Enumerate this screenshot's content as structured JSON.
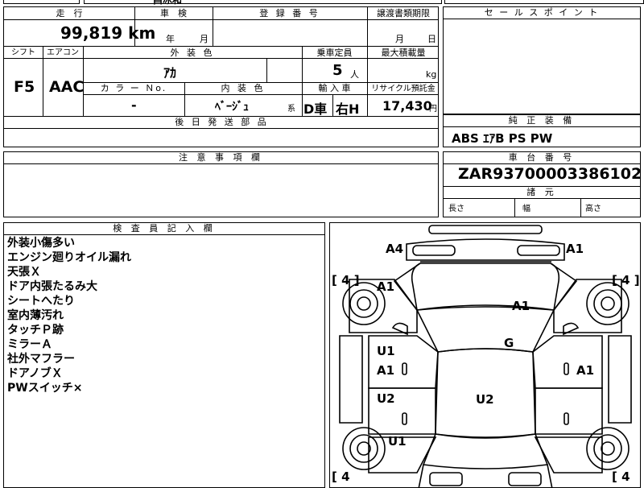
{
  "top_strip": {
    "fragment": "昌冰和"
  },
  "specs": {
    "mileage_label": "走　行",
    "mileage_value": "99,819 km",
    "inspection_label": "車　検",
    "inspection_year_unit": "年",
    "inspection_month_unit": "月",
    "registration_label": "登 録 番 号",
    "transfer_label": "譲渡書類期限",
    "transfer_month_unit": "月",
    "transfer_day_unit": "日",
    "shift_label": "シフト",
    "shift_value": "F5",
    "ac_label": "エアコン",
    "ac_value": "AAC",
    "exterior_label": "外 装 色",
    "exterior_value": "ｱｶ",
    "capacity_label": "乗車定員",
    "capacity_value": "5",
    "capacity_unit": "人",
    "payload_label": "最大積載量",
    "payload_unit": "kg",
    "color_no_label": "カ ラ ー Ｎo.",
    "color_no_value": "-",
    "interior_label": "内 装 色",
    "interior_value": "ﾍﾞｰｼﾞｭ",
    "interior_suffix": "系",
    "import_label": "輸 入 車",
    "import_type": "D車",
    "steering": "右H",
    "recycle_label": "リサイクル預託金",
    "recycle_value": "17,430",
    "recycle_unit": "円",
    "later_parts_label": "後 日 発 送 部 品"
  },
  "sales_point": {
    "label": "セ ー ル ス ポ イ ン ト"
  },
  "equipment": {
    "label": "純 正 装 備",
    "value": "ABS ｴｱB PS PW"
  },
  "caution": {
    "label": "注 意 事 項 欄"
  },
  "chassis": {
    "label": "車 台 番 号",
    "value": "ZAR93700003386102"
  },
  "dimensions": {
    "label": "諸 元",
    "length": "長さ",
    "width": "幅",
    "height": "高さ"
  },
  "inspector": {
    "label": "検 査 員 記 入 欄",
    "notes": [
      "外装小傷多い",
      "エンジン廻りオイル漏れ",
      "天張Ｘ",
      "ドア内張たるみ大",
      "シートへたり",
      "室内薄汚れ",
      "タッチＰ跡",
      "ミラーＡ",
      "社外マフラー",
      "ドアノブＸ",
      "PWスイッチ×"
    ]
  },
  "diagram": {
    "tire_left_front": "[ 4 ]",
    "tire_right_front": "[ 4 ]",
    "tire_left_rear": "[ 4",
    "tire_right_rear": "[ 4",
    "marks": {
      "front_left_bumper": "A4",
      "front_right_bumper": "A1",
      "left_fender": "A1",
      "hood": "A1",
      "windshield": "G",
      "left_front_door_u": "U1",
      "left_front_door_a": "A1",
      "right_front_door": "A1",
      "left_rear_door": "U2",
      "roof": "U2",
      "left_rear_fender": "U1"
    }
  }
}
